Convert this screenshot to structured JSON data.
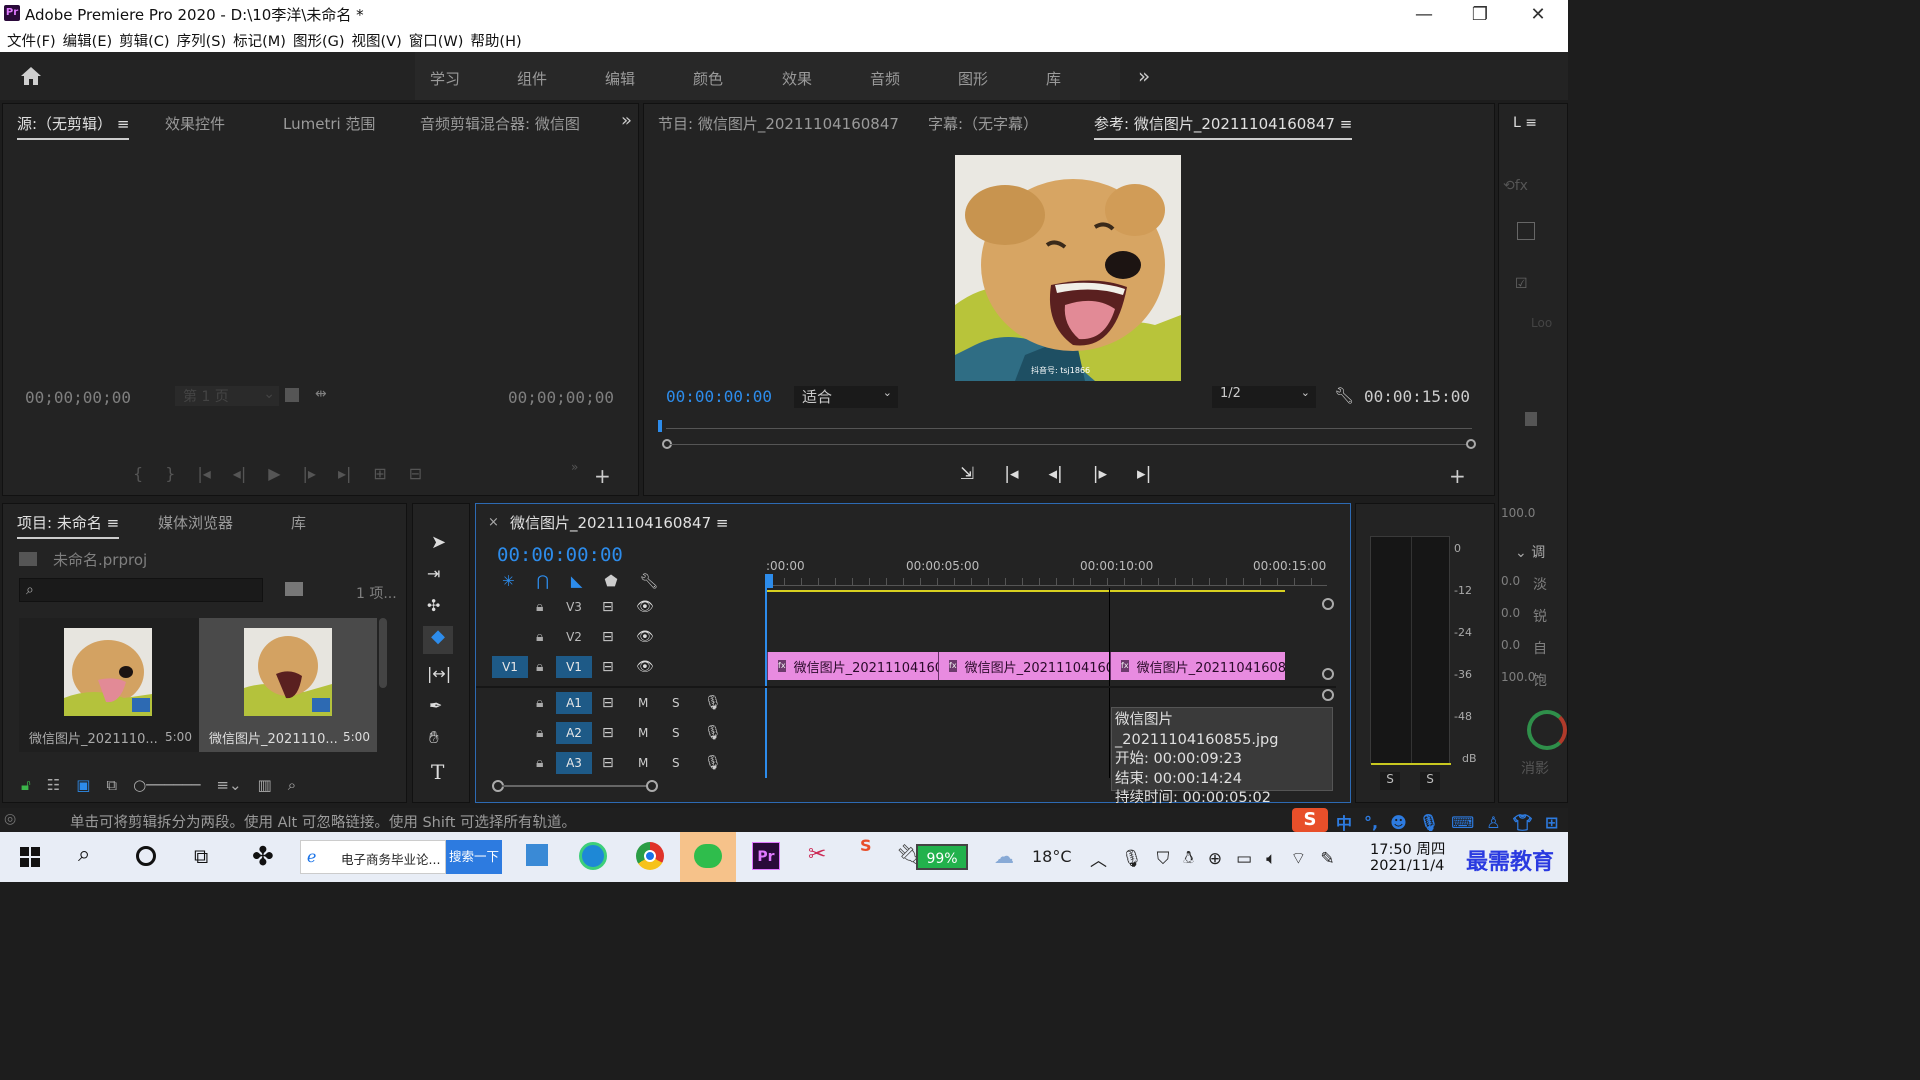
{
  "app": {
    "title": "Adobe Premiere Pro 2020 - D:\\10李洋\\未命名 *",
    "logo": "Pr",
    "window_controls": [
      "minimize-icon",
      "restore-icon",
      "close-icon"
    ]
  },
  "menu": [
    "文件(F)",
    "编辑(E)",
    "剪辑(C)",
    "序列(S)",
    "标记(M)",
    "图形(G)",
    "视图(V)",
    "窗口(W)",
    "帮助(H)"
  ],
  "workspaces": [
    "学习",
    "组件",
    "编辑",
    "颜色",
    "效果",
    "音频",
    "图形",
    "库"
  ],
  "workspace_more": "»",
  "source_panel": {
    "tabs": [
      "源:（无剪辑）",
      "效果控件",
      "Lumetri 范围",
      "音频剪辑混合器: 微信图"
    ],
    "more": "»",
    "timecode_left": "00;00;00;00",
    "timecode_right": "00;00;00;00",
    "page_dropdown": "第 1 页"
  },
  "program_panel": {
    "tabs": [
      "节目: 微信图片_20211104160847",
      "字幕:（无字幕）",
      "参考: 微信图片_20211104160847"
    ],
    "timecode": "00:00:00:00",
    "fit": "适合",
    "resolution": "1/2",
    "duration": "00:00:15:00",
    "watermark": "抖音号: tsj1866"
  },
  "side_panel": {
    "tab": "L",
    "labels": [
      "调",
      "淡",
      "锐",
      "自",
      "饱",
      "Loo"
    ],
    "values": [
      "100.0",
      "0.0",
      "0.0",
      "0.0",
      "100.0"
    ],
    "fade": "消影"
  },
  "project_panel": {
    "tabs": [
      "项目: 未命名",
      "媒体浏览器",
      "库"
    ],
    "file": "未命名.prproj",
    "count": "1 项...",
    "items": [
      {
        "name": "微信图片_2021110...",
        "duration": "5:00"
      },
      {
        "name": "微信图片_2021110...",
        "duration": "5:00"
      }
    ]
  },
  "timeline": {
    "tab": "微信图片_20211104160847",
    "timecode": "00:00:00:00",
    "ruler": [
      ":00:00",
      "00:00:05:00",
      "00:00:10:00",
      "00:00:15:00"
    ],
    "video_tracks": [
      {
        "name": "V3"
      },
      {
        "name": "V2"
      },
      {
        "name": "V1",
        "source": "V1"
      }
    ],
    "audio_tracks": [
      {
        "name": "A1"
      },
      {
        "name": "A2"
      },
      {
        "name": "A3"
      }
    ],
    "mute": "M",
    "solo": "S",
    "clips": [
      "微信图片_20211104160",
      "微信图片_20211104160",
      "微信图片_20211041608"
    ],
    "tooltip": [
      "微信图片_20211104160855.jpg",
      "开始: 00:00:09:23",
      "结束: 00:00:14:24",
      "持续时间: 00:00:05:02"
    ]
  },
  "audio_meter": {
    "scale": [
      "0",
      "-12",
      "-24",
      "-36",
      "-48",
      "dB"
    ],
    "solo_buttons": [
      "S",
      "S"
    ]
  },
  "status": "单击可将剪辑拆分为两段。使用 Alt 可忽略链接。使用 Shift 可选择所有轨道。",
  "ime": [
    "中",
    "°,"
  ],
  "taskbar": {
    "search_tab": "电子商务毕业论...",
    "search_btn": "搜索一下",
    "battery": "99%",
    "weather": "18°C",
    "time": "17:50 周四",
    "date": "2021/11/4",
    "watermark": "最需教育"
  },
  "colors": {
    "accent_blue": "#2d8ceb",
    "clip_pink": "#e88be0",
    "timeline_yellow": "#d8d020"
  }
}
